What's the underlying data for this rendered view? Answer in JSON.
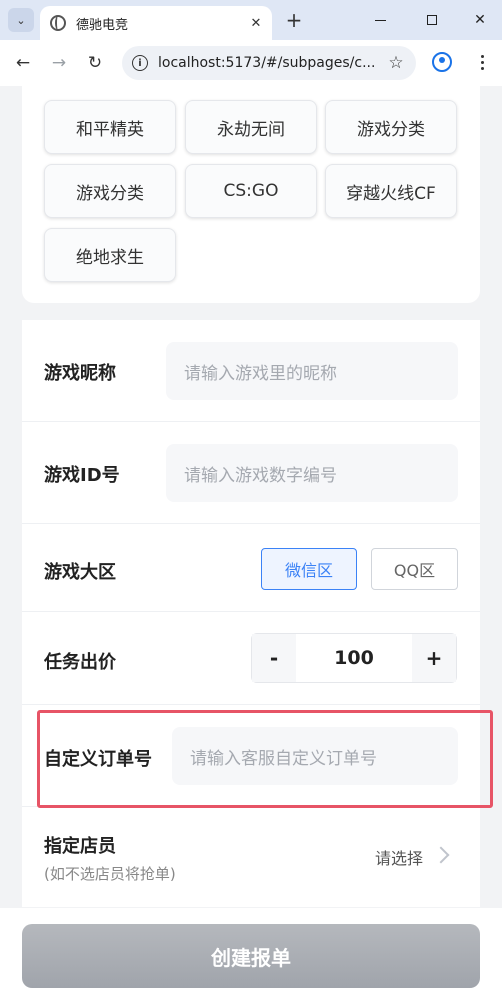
{
  "browser": {
    "tab_title": "德驰电竞",
    "url": "localhost:5173/#/subpages/c...",
    "new_tab_label": "+",
    "close_tab_label": "✕"
  },
  "games": {
    "chips": [
      "和平精英",
      "永劫无间",
      "游戏分类",
      "游戏分类",
      "CS:GO",
      "穿越火线CF",
      "绝地求生"
    ]
  },
  "form": {
    "nickname": {
      "label": "游戏昵称",
      "placeholder": "请输入游戏里的昵称"
    },
    "game_id": {
      "label": "游戏ID号",
      "placeholder": "请输入游戏数字编号"
    },
    "region": {
      "label": "游戏大区",
      "options": [
        "微信区",
        "QQ区"
      ],
      "selected": "微信区"
    },
    "price": {
      "label": "任务出价",
      "minus": "-",
      "value": "100",
      "plus": "+"
    },
    "custom_order": {
      "label": "自定义订单号",
      "placeholder": "请输入客服自定义订单号"
    },
    "staff": {
      "label": "指定店员",
      "hint": "(如不选店员将抢单)",
      "select_text": "请选择"
    }
  },
  "submit_label": "创建报单",
  "colors": {
    "accent": "#3b82f6",
    "highlight": "#e75466",
    "disabled_button": "#a0a4ab"
  }
}
